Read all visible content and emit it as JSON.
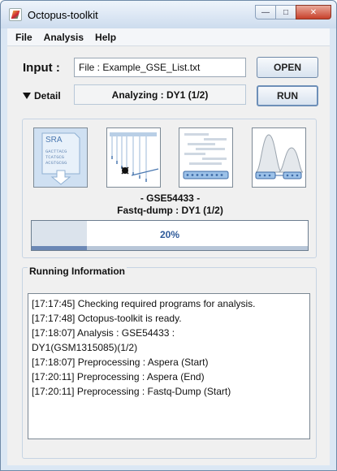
{
  "window": {
    "title": "Octopus-toolkit"
  },
  "menu": {
    "items": [
      "File",
      "Analysis",
      "Help"
    ]
  },
  "input": {
    "label": "Input :",
    "file_value": "File : Example_GSE_List.txt",
    "open_label": "OPEN"
  },
  "detail": {
    "label": "Detail",
    "status": "Analyzing : DY1 (1/2)",
    "run_label": "RUN"
  },
  "pipeline": {
    "steps": [
      {
        "name": "SRA",
        "seq": [
          "GACTTACG",
          "TCATGCG",
          "ACGTGCGG"
        ]
      },
      {
        "name": "Alignment"
      },
      {
        "name": "Reads"
      },
      {
        "name": "Peaks"
      }
    ],
    "line1": "- GSE54433 -",
    "line2": "Fastq-dump : DY1 (1/2)",
    "progress_percent": 20,
    "progress_text": "20%"
  },
  "running_info": {
    "title": "Running Information",
    "lines": [
      "[17:17:45] Checking required programs for analysis.",
      "[17:17:48] Octopus-toolkit is ready.",
      "[17:18:07] Analysis : GSE54433 :",
      "DY1(GSM1315085)(1/2)",
      "[17:18:07] Preprocessing : Aspera (Start)",
      "[17:20:11] Preprocessing : Aspera (End)",
      "[17:20:11] Preprocessing : Fastq-Dump (Start)"
    ]
  },
  "colors": {
    "accent": "#2f5b9a",
    "progress_strip": "#6b88b5",
    "title_gradient_top": "#eef4fb",
    "close_button": "#c8402a"
  }
}
